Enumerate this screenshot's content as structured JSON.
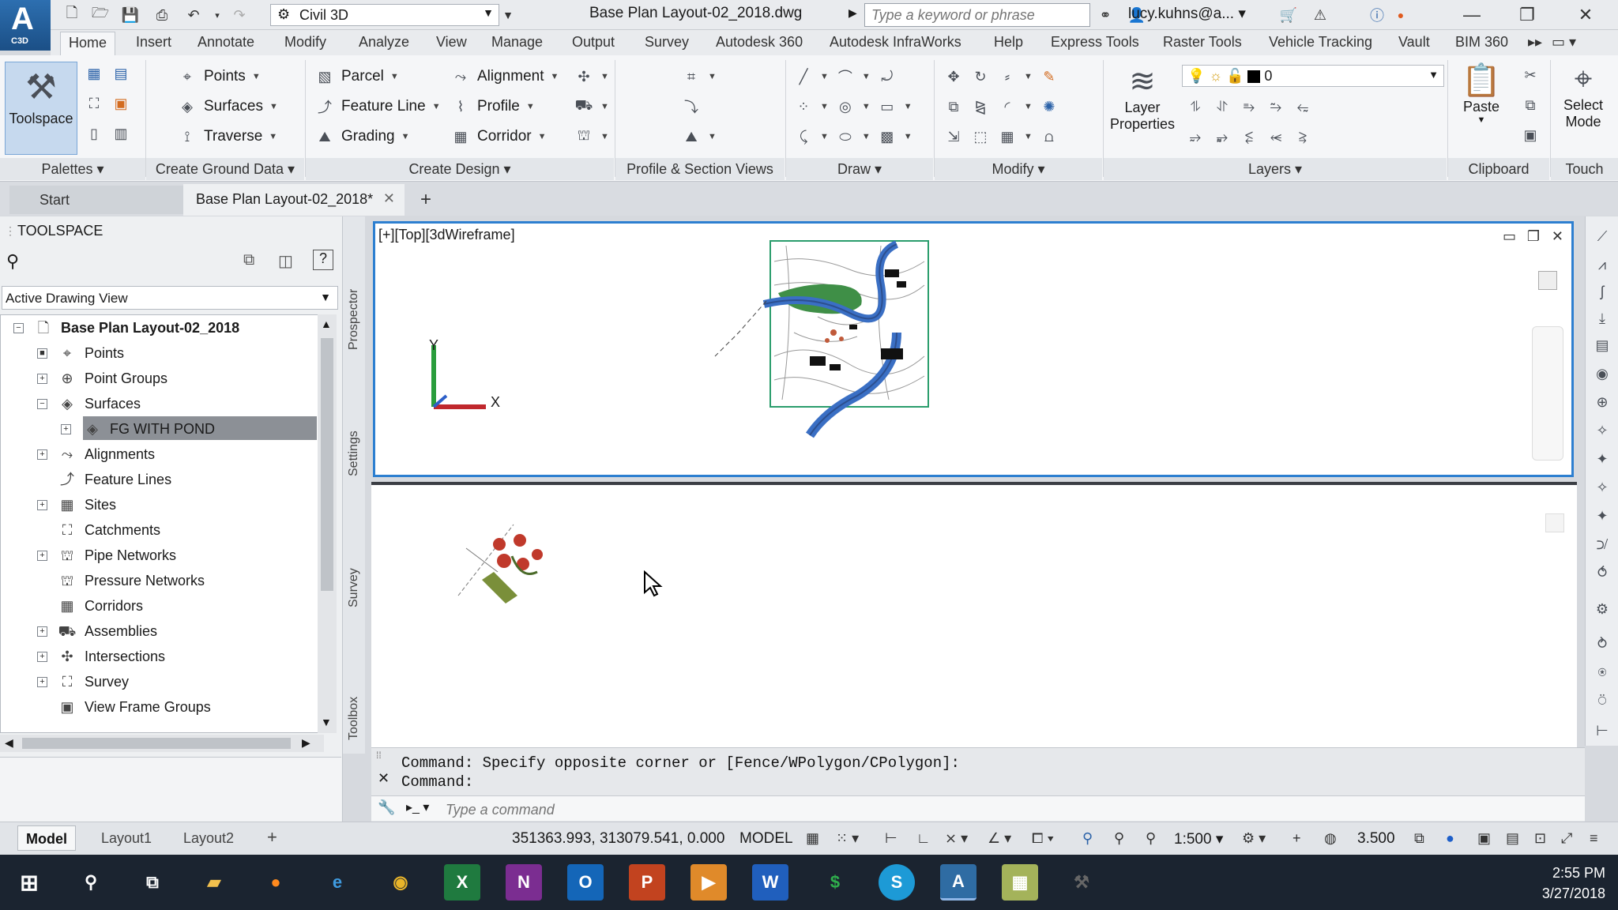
{
  "app": {
    "logo_letter": "A",
    "logo_sub": "C3D",
    "workspace": "Civil 3D",
    "document_title": "Base Plan Layout-02_2018.dwg",
    "search_placeholder": "Type a keyword or phrase",
    "user": "lucy.kuhns@a..."
  },
  "ribbon_tabs": [
    "Home",
    "Insert",
    "Annotate",
    "Modify",
    "Analyze",
    "View",
    "Manage",
    "Output",
    "Survey",
    "Autodesk 360",
    "Autodesk InfraWorks",
    "Help",
    "Express Tools",
    "Raster Tools",
    "Vehicle Tracking",
    "Vault",
    "BIM 360"
  ],
  "ribbon": {
    "toolspace": "Toolspace",
    "points": "Points",
    "surfaces": "Surfaces",
    "traverse": "Traverse",
    "parcel": "Parcel",
    "feature_line": "Feature Line",
    "grading": "Grading",
    "alignment": "Alignment",
    "profile": "Profile",
    "corridor": "Corridor",
    "layer_properties_1": "Layer",
    "layer_properties_2": "Properties",
    "layer_value": "0",
    "paste": "Paste",
    "select_mode_1": "Select",
    "select_mode_2": "Mode",
    "panels": [
      "Palettes",
      "Create Ground Data",
      "Create Design",
      "Profile & Section Views",
      "Draw",
      "Modify",
      "Layers",
      "Clipboard",
      "Touch"
    ]
  },
  "doc_tabs": {
    "start": "Start",
    "current": "Base Plan Layout-02_2018*"
  },
  "toolspace": {
    "title": "TOOLSPACE",
    "view_select": "Active Drawing View",
    "root": "Base Plan Layout-02_2018",
    "items": [
      "Points",
      "Point Groups",
      "Surfaces",
      "FG WITH POND",
      "Alignments",
      "Feature Lines",
      "Sites",
      "Catchments",
      "Pipe Networks",
      "Pressure Networks",
      "Corridors",
      "Assemblies",
      "Intersections",
      "Survey",
      "View Frame Groups"
    ],
    "side_tabs": [
      "Prospector",
      "Settings",
      "Survey",
      "Toolbox"
    ]
  },
  "viewport": {
    "label": "[+][Top][3dWireframe]",
    "axis_y": "Y",
    "axis_x": "X"
  },
  "command": {
    "line1": "Command: Specify opposite corner or [Fence/WPolygon/CPolygon]:",
    "line2": "Command:",
    "placeholder": "Type a command"
  },
  "layout_tabs": [
    "Model",
    "Layout1",
    "Layout2"
  ],
  "status": {
    "coords": "351363.993, 313079.541, 0.000",
    "mode": "MODEL",
    "scale": "1:500",
    "lineweight": "3.500"
  },
  "clock": {
    "time": "2:55 PM",
    "date": "3/27/2018"
  }
}
